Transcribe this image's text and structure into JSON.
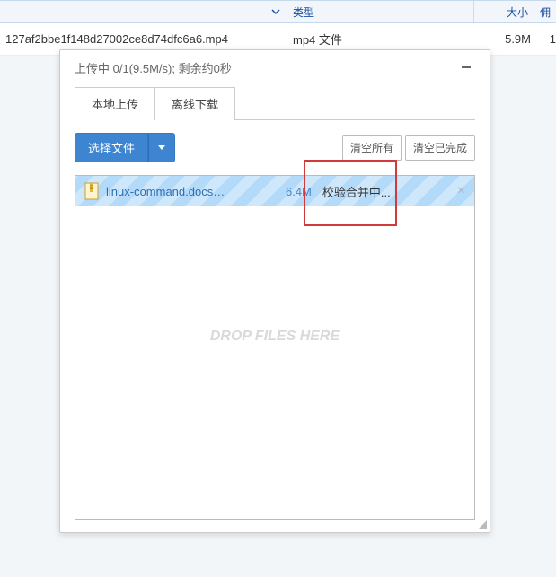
{
  "table": {
    "headers": {
      "name": "",
      "type": "类型",
      "size": "大小",
      "last": "佣"
    },
    "row": {
      "name": "127af2bbe1f148d27002ce8d74dfc6a6.mp4",
      "type": "mp4 文件",
      "size": "5.9M",
      "last": "1"
    }
  },
  "panel": {
    "status": "上传中 0/1(9.5M/s); 剩余约0秒",
    "tabs": {
      "local": "本地上传",
      "offline": "离线下载"
    },
    "select_button": "选择文件",
    "clear_all": "清空所有",
    "clear_done": "清空已完成",
    "item": {
      "name": "linux-command.docs…",
      "size": "6.4M",
      "status": "校验合并中...",
      "close": "×"
    },
    "drop_text": "DROP FILES HERE",
    "minimize": "—"
  }
}
